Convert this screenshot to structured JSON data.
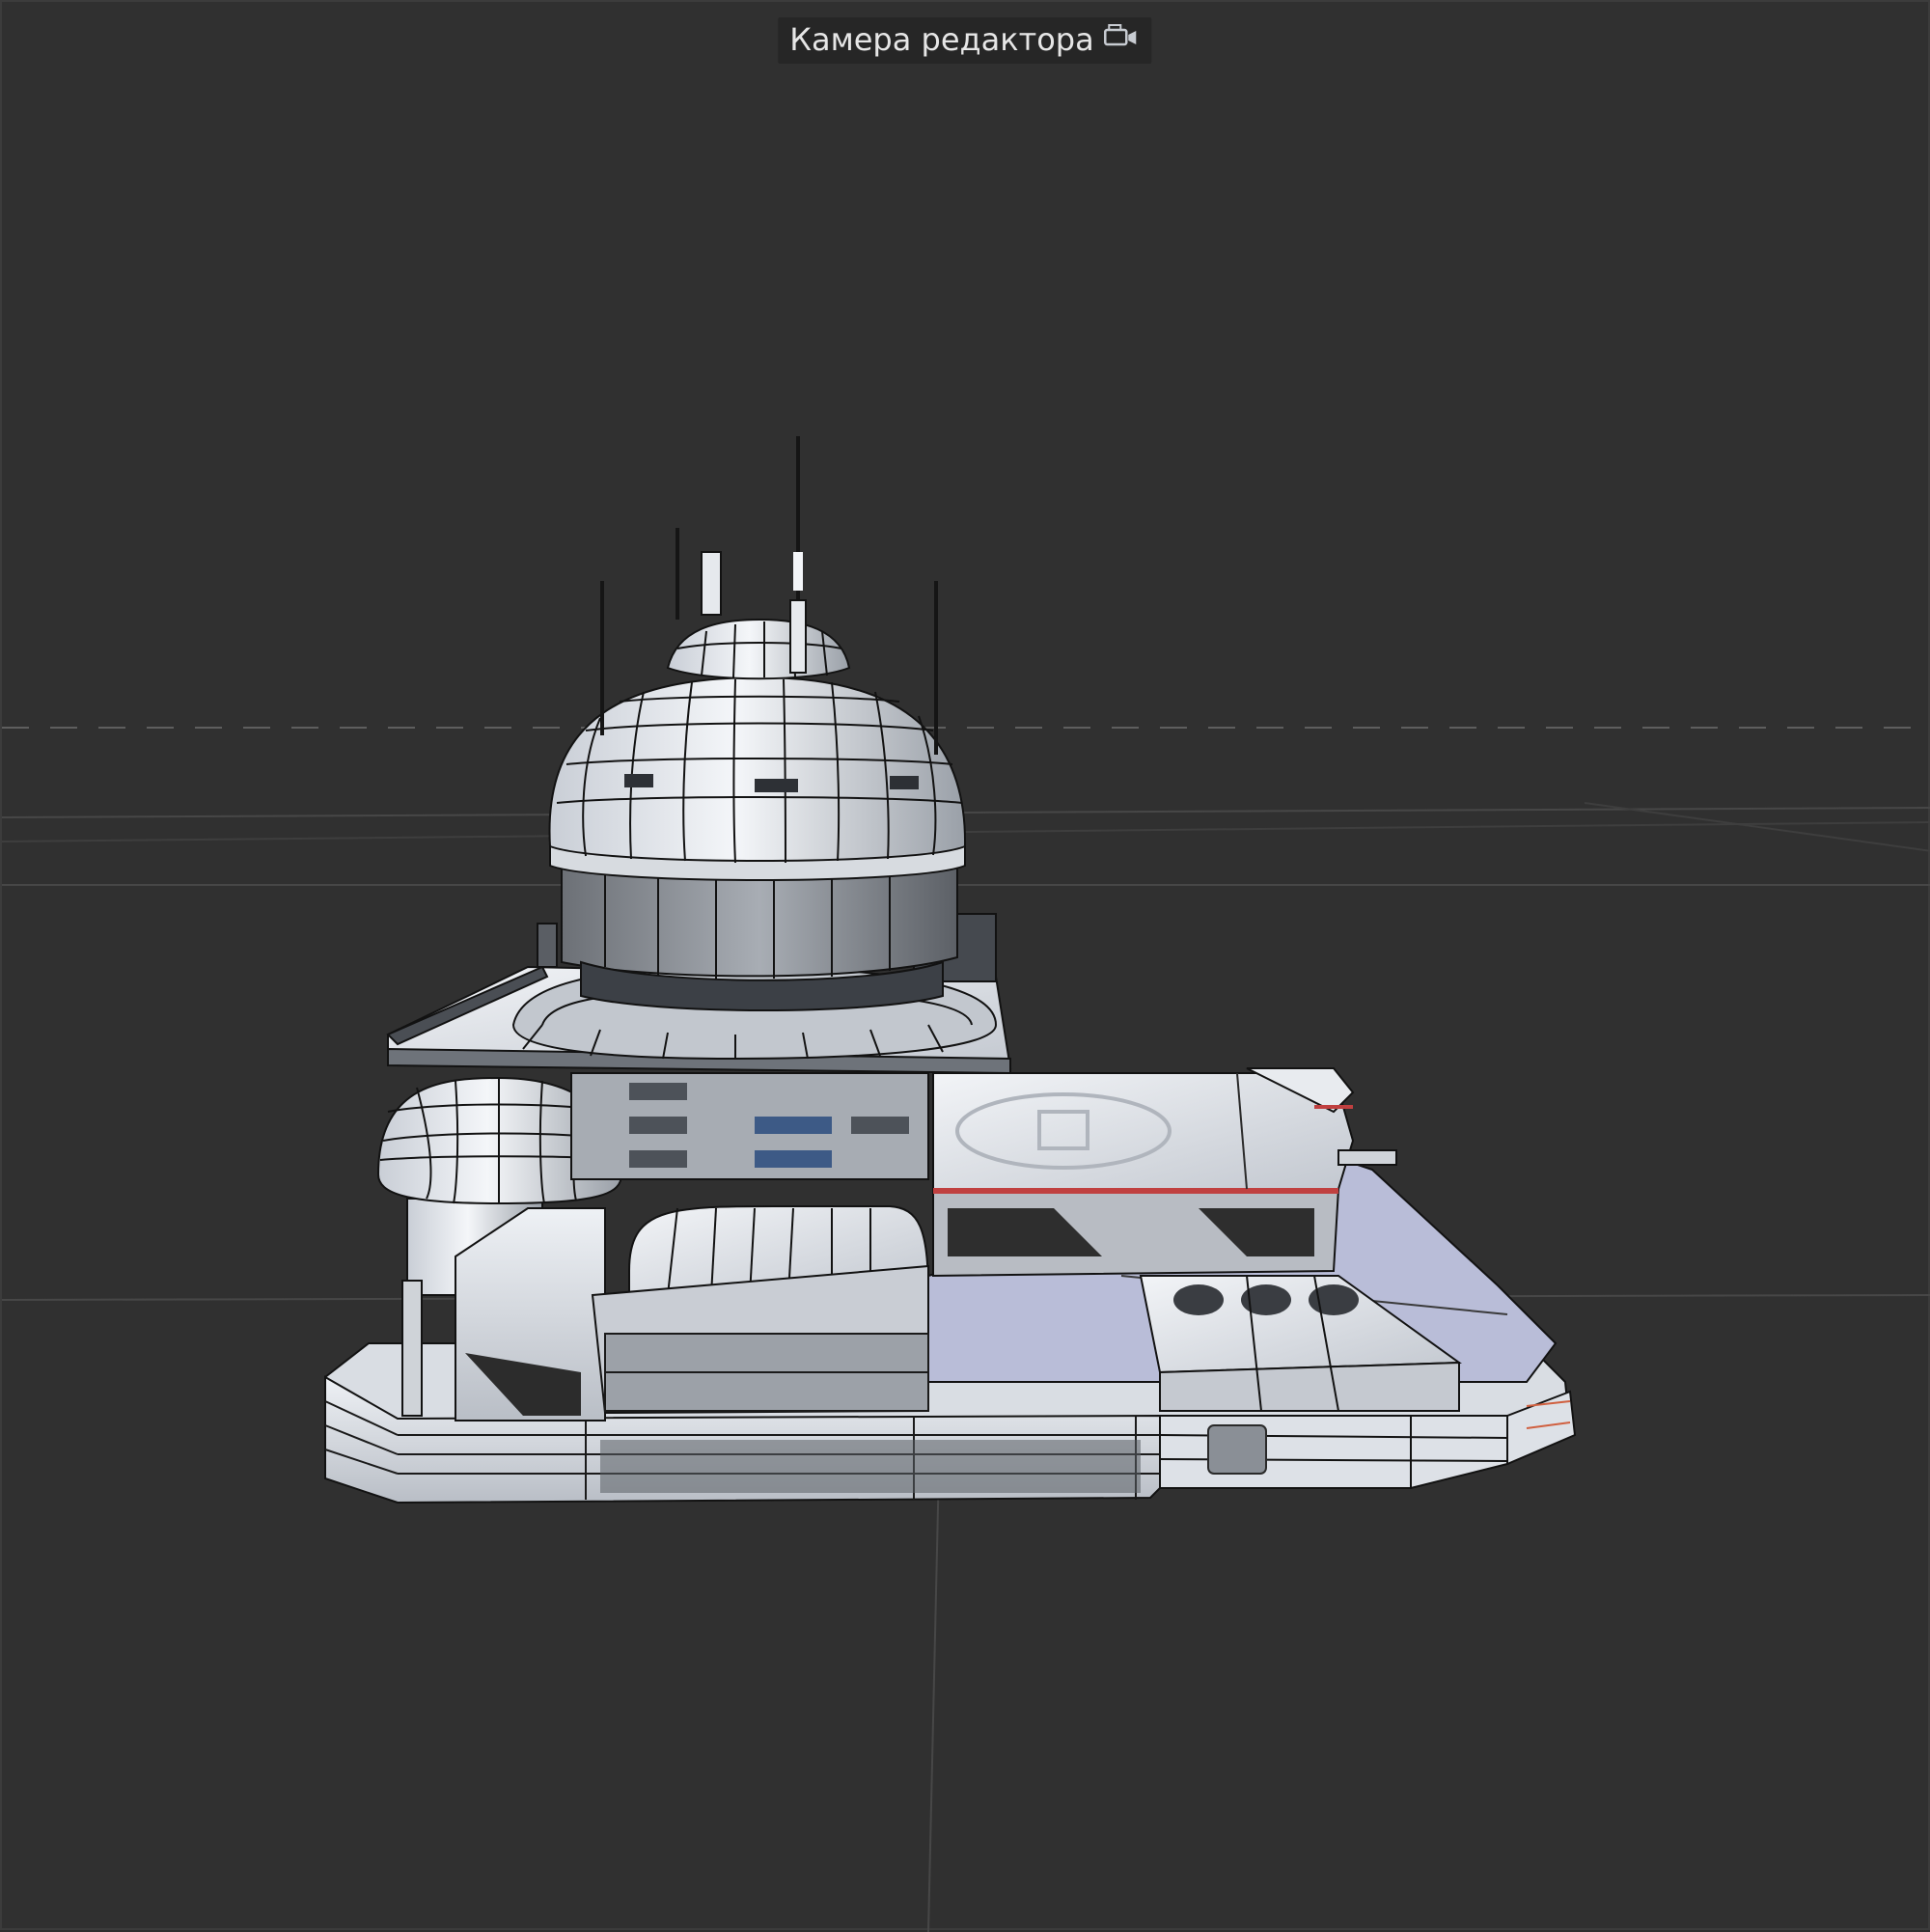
{
  "viewport": {
    "camera_label": "Камера редактора",
    "camera_icon": "camera-icon",
    "background_color": "#303030",
    "grid_color": "#4a4a4a",
    "horizon_color": "#5a5a5a"
  },
  "model": {
    "icon": "3d-building-model",
    "base_color": "#e3e8ee",
    "shade_color": "#8a9098",
    "wire_color": "#101010",
    "accent_color": "#c04040",
    "floor_color": "#b9bdd8"
  }
}
